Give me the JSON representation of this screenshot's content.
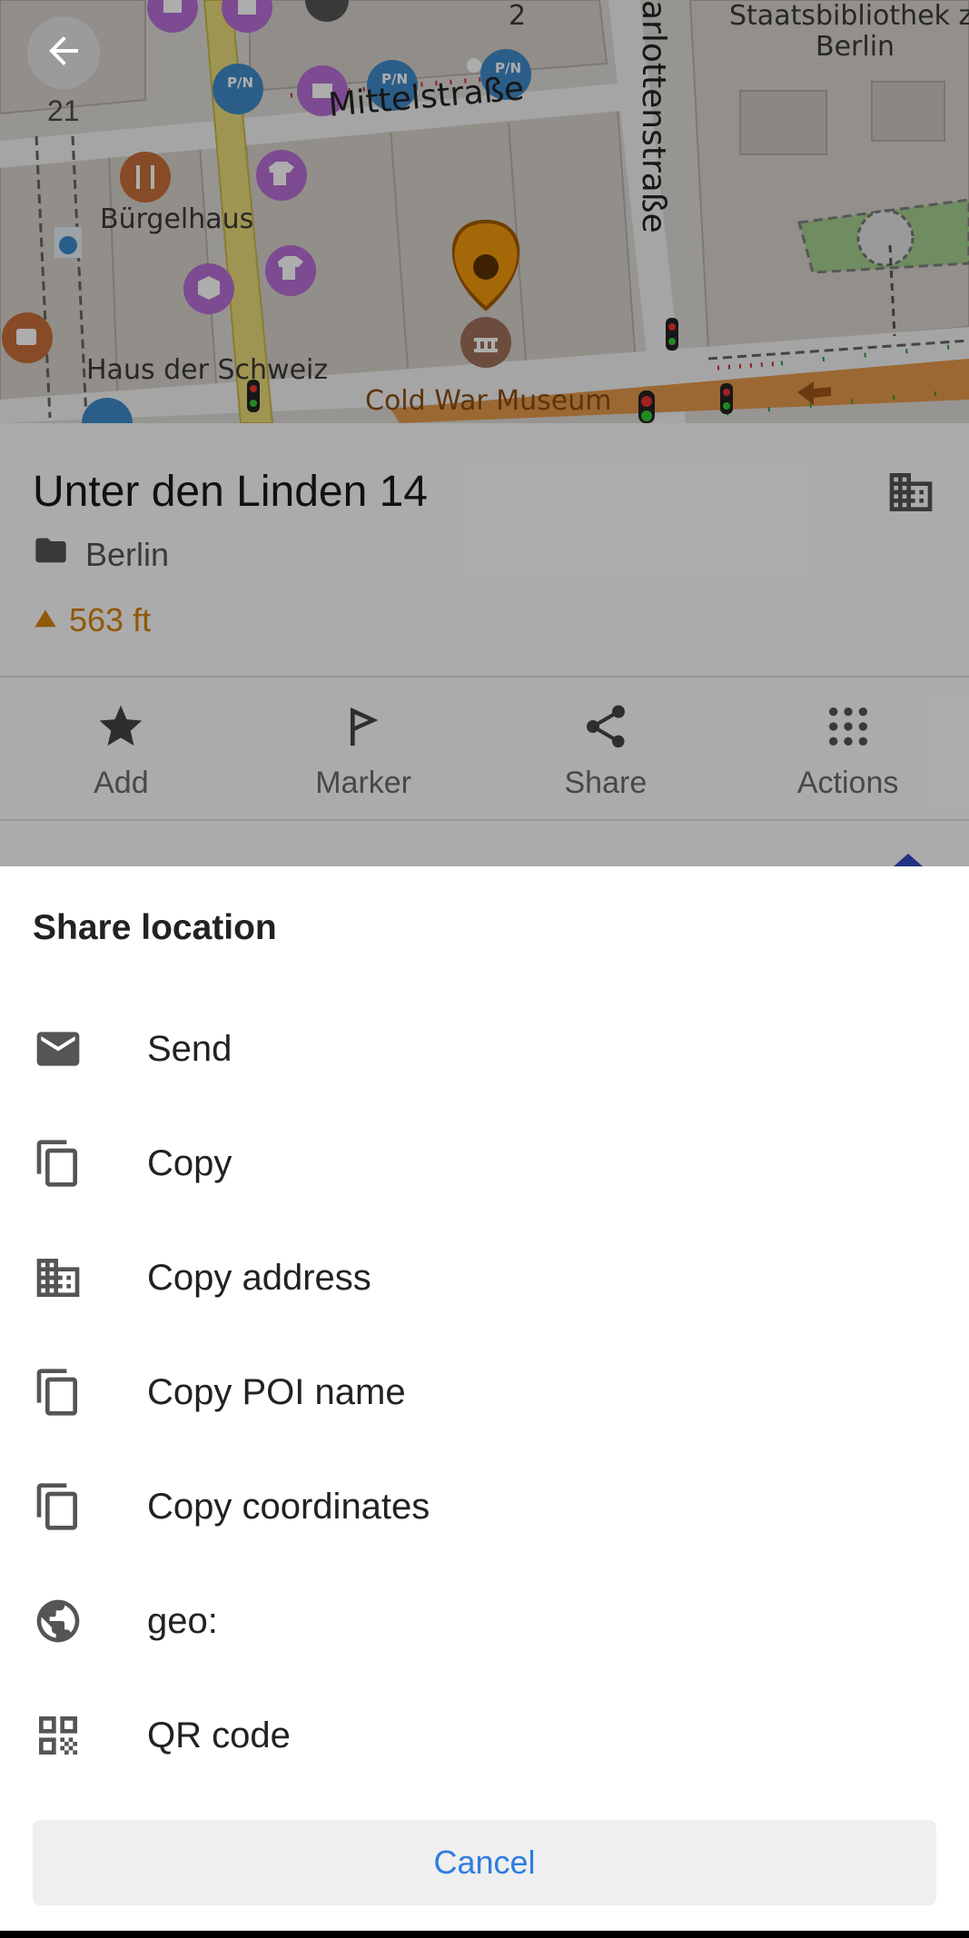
{
  "map": {
    "zoom_level": "21",
    "labels": {
      "building_number": "2",
      "library_line1": "Staatsbibliothek zu",
      "library_line2": "Berlin",
      "street_mittel": "Mittelstraße",
      "street_charlotten": "arlottenstraße",
      "restaurant": "Bürgelhaus",
      "haus_schweiz": "Haus der Schweiz",
      "museum": "Cold War Museum"
    }
  },
  "card": {
    "title": "Unter den Linden 14",
    "folder": "Berlin",
    "elevation": "563 ft",
    "actions": [
      {
        "label": "Add",
        "icon": "star-icon"
      },
      {
        "label": "Marker",
        "icon": "flag-icon"
      },
      {
        "label": "Share",
        "icon": "share-icon"
      },
      {
        "label": "Actions",
        "icon": "grid-dots-icon"
      }
    ]
  },
  "sheet": {
    "title": "Share location",
    "items": [
      {
        "label": "Send",
        "icon": "mail-icon"
      },
      {
        "label": "Copy",
        "icon": "copy-icon"
      },
      {
        "label": "Copy address",
        "icon": "building-icon"
      },
      {
        "label": "Copy POI name",
        "icon": "copy-icon"
      },
      {
        "label": "Copy coordinates",
        "icon": "copy-icon"
      },
      {
        "label": "geo:",
        "icon": "globe-icon"
      },
      {
        "label": "QR code",
        "icon": "qr-code-icon"
      }
    ],
    "cancel_label": "Cancel"
  },
  "colors": {
    "accent": "#2f7de1",
    "elevation": "#d4830d",
    "marker": "#f39a0d",
    "poi_purple": "#b86fd6",
    "poi_blue": "#3f8bc9",
    "poi_brown": "#c96f3a"
  }
}
